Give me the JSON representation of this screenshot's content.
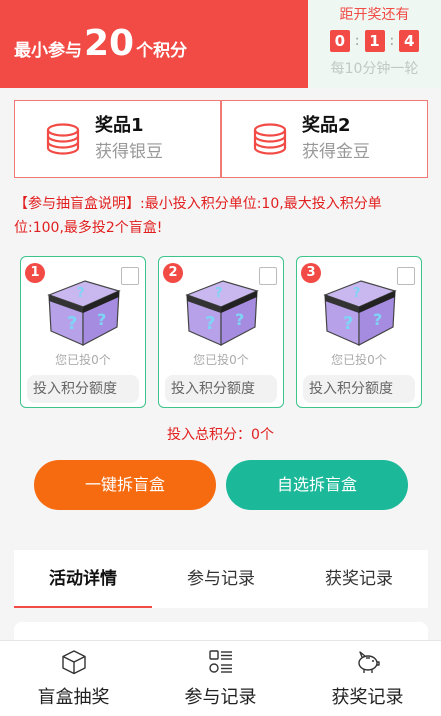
{
  "header": {
    "min_prefix": "最小参与",
    "min_value": "20",
    "min_suffix": "个积分",
    "countdown_title": "距开奖还有",
    "countdown": [
      "0",
      "1",
      "4"
    ],
    "countdown_sep": ":",
    "countdown_note": "每10分钟一轮"
  },
  "prizes": [
    {
      "title": "奖品1",
      "subtitle": "获得银豆",
      "icon": "coin-stack-icon"
    },
    {
      "title": "奖品2",
      "subtitle": "获得金豆",
      "icon": "coin-stack-icon"
    }
  ],
  "rule_text": "【参与抽盲盒说明】:最小投入积分单位:10,最大投入积分单位:100,最多投2个盲盒!",
  "boxes": [
    {
      "number": "1",
      "invested": "您已投0个",
      "input_placeholder": "投入积分额度",
      "checked": false
    },
    {
      "number": "2",
      "invested": "您已投0个",
      "input_placeholder": "投入积分额度",
      "checked": false
    },
    {
      "number": "3",
      "invested": "您已投0个",
      "input_placeholder": "投入积分额度",
      "checked": false
    }
  ],
  "total_text": "投入总积分：0个",
  "actions": {
    "one_click": "一键拆盲盒",
    "self_select": "自选拆盲盒"
  },
  "tabs": [
    {
      "label": "活动详情",
      "active": true
    },
    {
      "label": "参与记录",
      "active": false
    },
    {
      "label": "获奖记录",
      "active": false
    }
  ],
  "bottom_nav": [
    {
      "label": "盲盒抽奖",
      "icon": "cube-icon"
    },
    {
      "label": "参与记录",
      "icon": "list-icon"
    },
    {
      "label": "获奖记录",
      "icon": "piggy-bank-icon"
    }
  ],
  "colors": {
    "brand_red": "#f24a45",
    "orange": "#f66b10",
    "green": "#1bb99a",
    "card_border_green": "#3cc48a"
  }
}
